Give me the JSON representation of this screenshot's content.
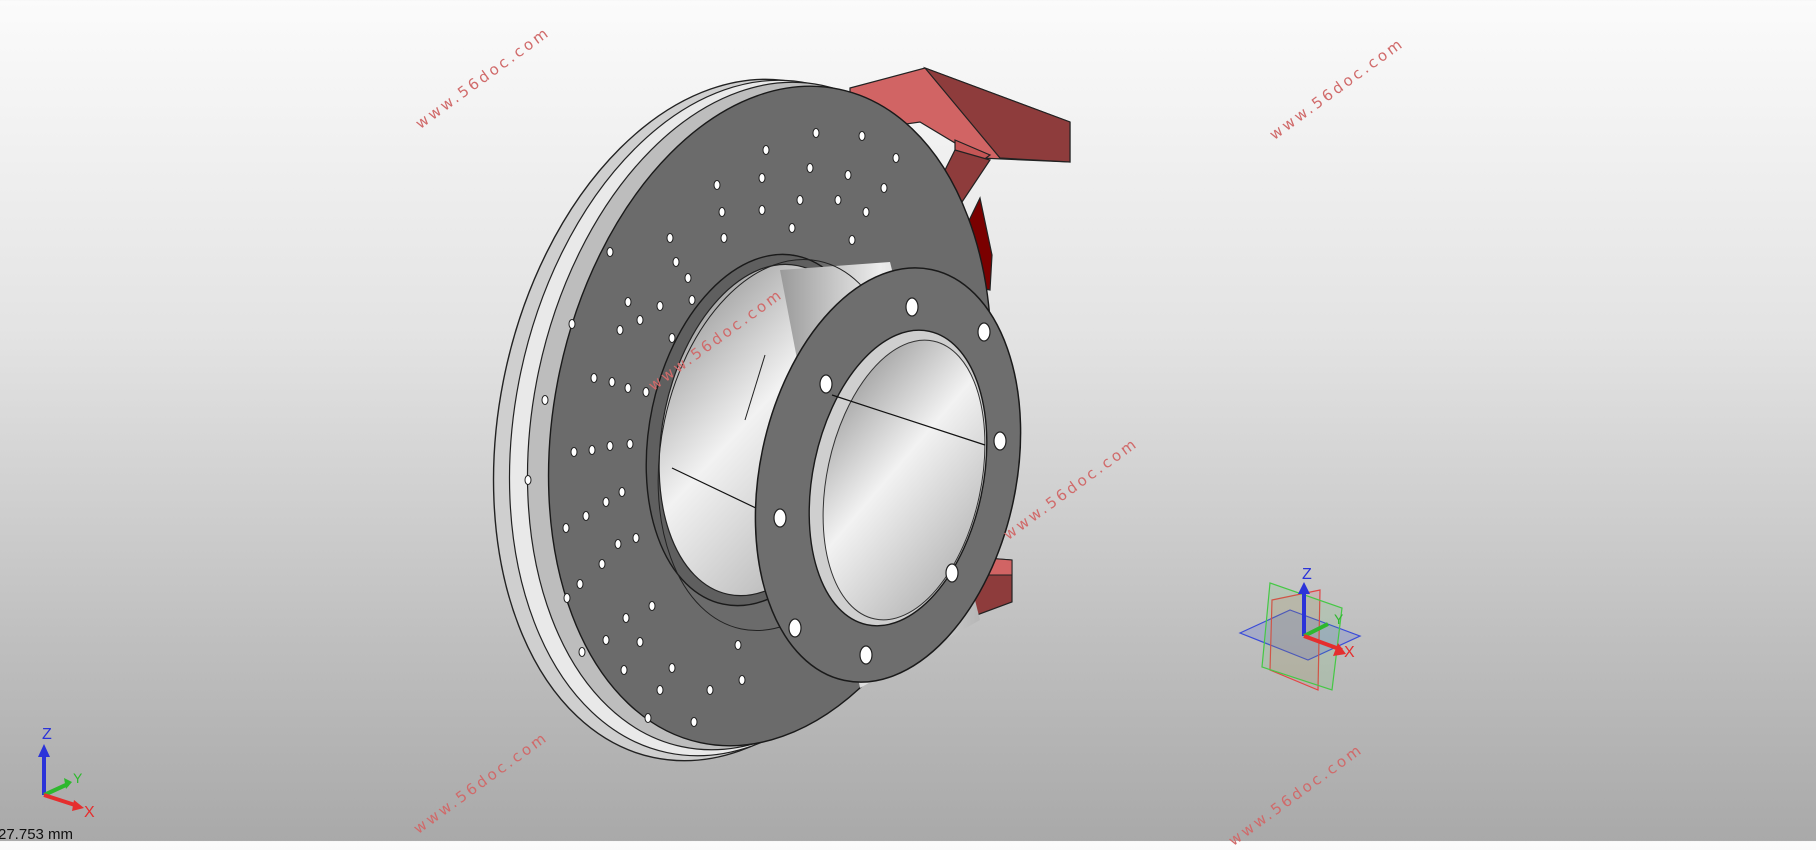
{
  "viewport": {
    "background": [
      "#fbfbfb",
      "#a9a9a9"
    ],
    "scale_readout": "27.753 mm"
  },
  "model": {
    "rotor_color": "#6b6b6b",
    "hub_color": "#d8d8d8",
    "caliper_colors": [
      "#d16464",
      "#8e3c3c",
      "#7a0000"
    ]
  },
  "axis_triad": {
    "z_label": "Z",
    "y_label": "Y",
    "x_label": "X"
  },
  "view_cube": {
    "z_label": "Z",
    "y_label": "Y",
    "x_label": "X"
  },
  "watermarks": {
    "w1": "www.56doc.com",
    "w2": "www.56doc.com",
    "w3": "www.56doc.com",
    "w4": "www.56doc.com",
    "w5": "www.56doc.com",
    "w6": "www.56doc.com"
  }
}
